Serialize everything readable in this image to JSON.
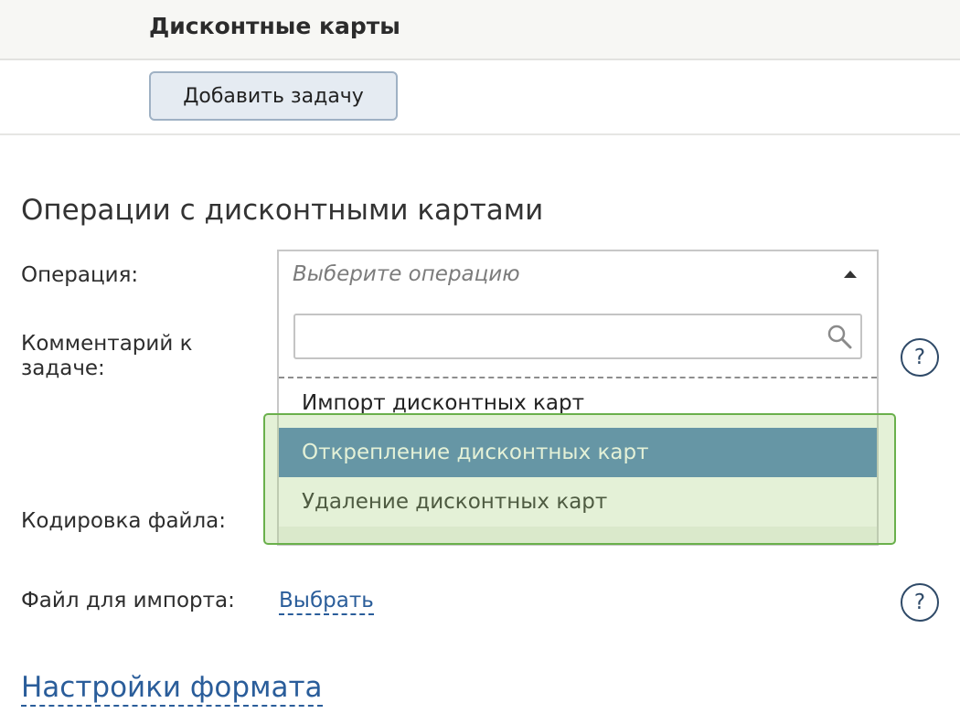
{
  "header": {
    "title": "Дисконтные карты"
  },
  "toolbar": {
    "add_task_label": "Добавить задачу"
  },
  "form": {
    "section_title": "Операции с дисконтными картами",
    "operation_label": "Операция:",
    "operation_placeholder": "Выберите операцию",
    "comment_label": "Комментарий к задаче:",
    "encoding_label": "Кодировка файла:",
    "file_label": "Файл для импорта:",
    "file_link": "Выбрать",
    "help_symbol": "?"
  },
  "dropdown": {
    "search_value": "",
    "options": [
      {
        "label": "Импорт дисконтных карт",
        "highlighted": false
      },
      {
        "label": "Открепление дисконтных карт",
        "highlighted": true
      },
      {
        "label": "Удаление дисконтных карт",
        "highlighted": false
      }
    ]
  },
  "format_settings": {
    "label": "Настройки формата"
  },
  "colors": {
    "accent": "#4679b6",
    "link": "#2a5d9a",
    "highlight_border": "#6ab04c"
  }
}
